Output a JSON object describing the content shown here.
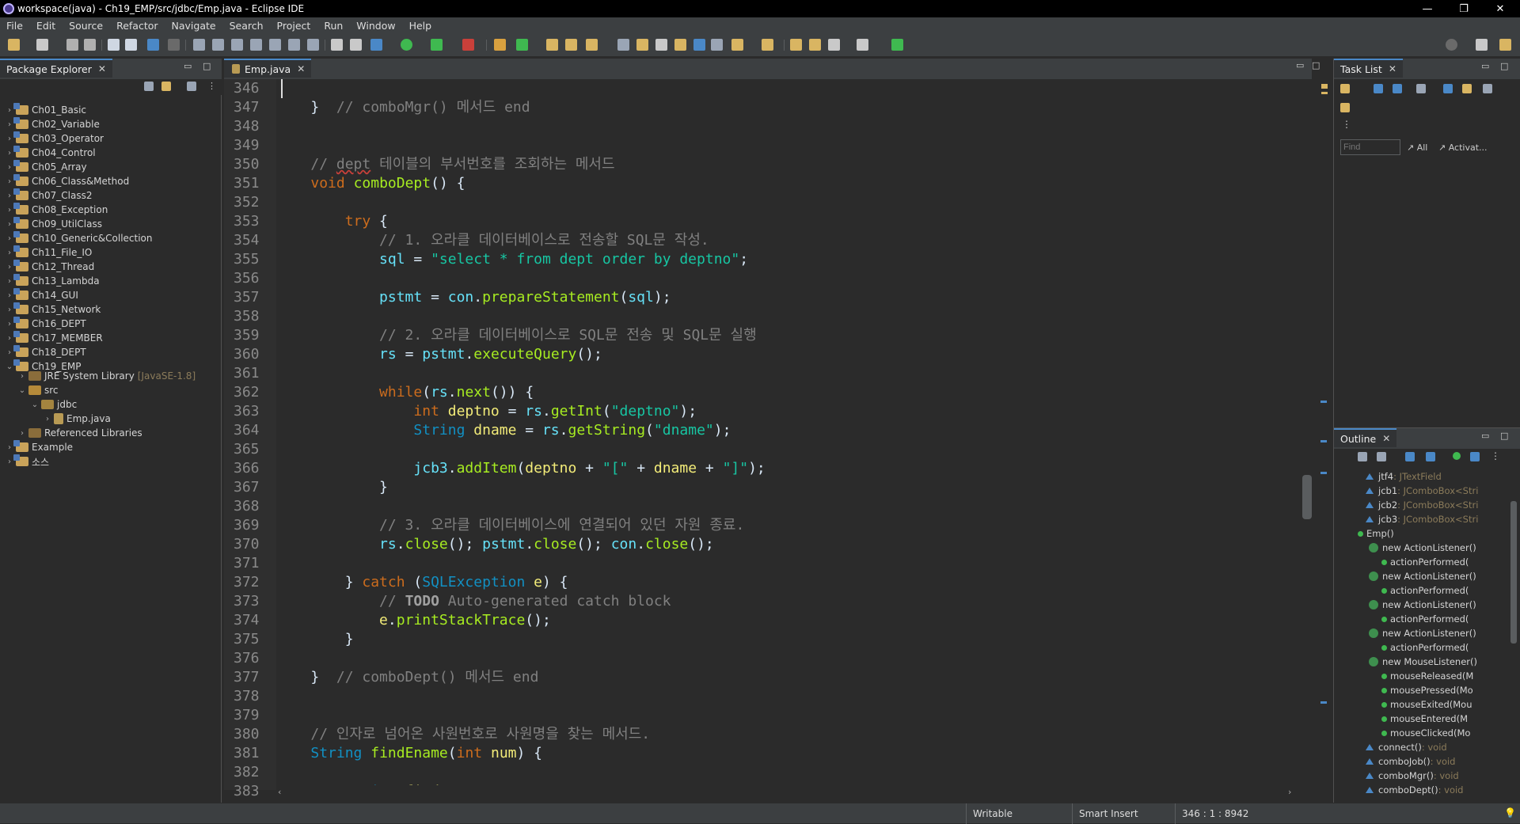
{
  "window": {
    "title": "workspace(java) - Ch19_EMP/src/jdbc/Emp.java - Eclipse IDE",
    "min": "—",
    "max": "❐",
    "close": "✕"
  },
  "menu": [
    "File",
    "Edit",
    "Source",
    "Refactor",
    "Navigate",
    "Search",
    "Project",
    "Run",
    "Window",
    "Help"
  ],
  "package_explorer": {
    "tab": "Package Explorer",
    "items": [
      {
        "label": "Ch01_Basic"
      },
      {
        "label": "Ch02_Variable"
      },
      {
        "label": "Ch03_Operator"
      },
      {
        "label": "Ch04_Control"
      },
      {
        "label": "Ch05_Array"
      },
      {
        "label": "Ch06_Class&Method"
      },
      {
        "label": "Ch07_Class2"
      },
      {
        "label": "Ch08_Exception"
      },
      {
        "label": "Ch09_UtilClass"
      },
      {
        "label": "Ch10_Generic&Collection"
      },
      {
        "label": "Ch11_File_IO"
      },
      {
        "label": "Ch12_Thread"
      },
      {
        "label": "Ch13_Lambda"
      },
      {
        "label": "Ch14_GUI"
      },
      {
        "label": "Ch15_Network"
      },
      {
        "label": "Ch16_DEPT"
      },
      {
        "label": "Ch17_MEMBER"
      },
      {
        "label": "Ch18_DEPT"
      },
      {
        "label": "Ch19_EMP"
      }
    ],
    "jre": {
      "label": "JRE System Library",
      "deco": "[JavaSE-1.8]"
    },
    "src": "src",
    "jdbc": "jdbc",
    "emp": "Emp.java",
    "reflibs": "Referenced Libraries",
    "example": "Example",
    "sosu": "소스"
  },
  "editor": {
    "tab": "Emp.java",
    "line_numbers": [
      "346",
      "347",
      "348",
      "349",
      "350",
      "351",
      "352",
      "353",
      "354",
      "355",
      "356",
      "357",
      "358",
      "359",
      "360",
      "361",
      "362",
      "363",
      "364",
      "365",
      "366",
      "367",
      "368",
      "369",
      "370",
      "371",
      "372",
      "373",
      "374",
      "375",
      "376",
      "377",
      "378",
      "379",
      "380",
      "381",
      "382",
      "383"
    ]
  },
  "task_list": {
    "tab": "Task List",
    "find_placeholder": "Find",
    "all": "All",
    "activate": "Activat..."
  },
  "outline": {
    "tab": "Outline",
    "rows": [
      {
        "name": "jtf4",
        "type": " : JTextField"
      },
      {
        "name": "jcb1",
        "type": " : JComboBox<Stri"
      },
      {
        "name": "jcb2",
        "type": " : JComboBox<Stri"
      },
      {
        "name": "jcb3",
        "type": " : JComboBox<Stri"
      },
      {
        "name": "Emp()",
        "type": ""
      },
      {
        "name": "new ActionListener()",
        "type": ""
      },
      {
        "name": "actionPerformed(",
        "type": ""
      },
      {
        "name": "new ActionListener()",
        "type": ""
      },
      {
        "name": "actionPerformed(",
        "type": ""
      },
      {
        "name": "new ActionListener()",
        "type": ""
      },
      {
        "name": "actionPerformed(",
        "type": ""
      },
      {
        "name": "new ActionListener()",
        "type": ""
      },
      {
        "name": "actionPerformed(",
        "type": ""
      },
      {
        "name": "new MouseListener()",
        "type": ""
      },
      {
        "name": "mouseReleased(M",
        "type": ""
      },
      {
        "name": "mousePressed(Mo",
        "type": ""
      },
      {
        "name": "mouseExited(Mou",
        "type": ""
      },
      {
        "name": "mouseEntered(M",
        "type": ""
      },
      {
        "name": "mouseClicked(Mo",
        "type": ""
      },
      {
        "name": "connect()",
        "type": " : void"
      },
      {
        "name": "comboJob()",
        "type": " : void"
      },
      {
        "name": "comboMgr()",
        "type": " : void"
      },
      {
        "name": "comboDept()",
        "type": " : void"
      }
    ]
  },
  "status": {
    "writable": "Writable",
    "insert": "Smart Insert",
    "position": "346 : 1 : 8942"
  },
  "colors": {
    "accent": "#4a88c7",
    "keyword": "#cc6c1d",
    "string": "#17c6a3",
    "field": "#66e1f8",
    "method": "#a7ec21",
    "comment": "#808080"
  }
}
